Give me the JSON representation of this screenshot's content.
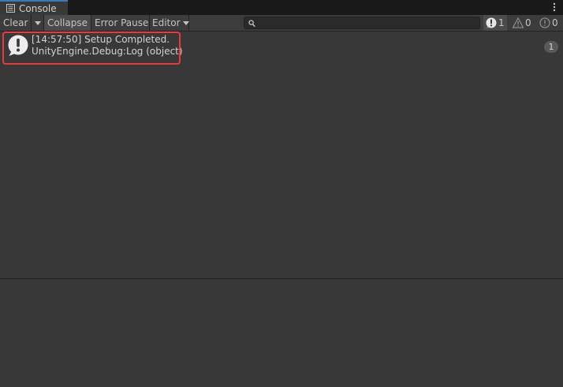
{
  "window": {
    "tab_title": "Console",
    "tab_icon": "console-list-icon",
    "menu_icon": "vertical-ellipsis-icon"
  },
  "toolbar": {
    "clear_label": "Clear",
    "clear_dropdown_icon": "caret-down-icon",
    "collapse_label": "Collapse",
    "error_pause_label": "Error Pause",
    "editor_label": "Editor",
    "editor_dropdown_icon": "caret-down-icon",
    "search": {
      "placeholder": "",
      "value": "",
      "icon": "search-icon"
    },
    "counters": {
      "info": {
        "icon": "info-icon",
        "count": "1"
      },
      "warning": {
        "icon": "warning-icon",
        "count": "0"
      },
      "error": {
        "icon": "error-icon",
        "count": "0"
      }
    }
  },
  "logs": [
    {
      "icon": "info-icon",
      "line1": "[14:57:50] Setup Completed.",
      "line2": "UnityEngine.Debug:Log (object)",
      "count": "1"
    }
  ],
  "colors": {
    "highlight": "#e63b3b",
    "tab_accent": "#3a79bb",
    "background": "#383838"
  }
}
